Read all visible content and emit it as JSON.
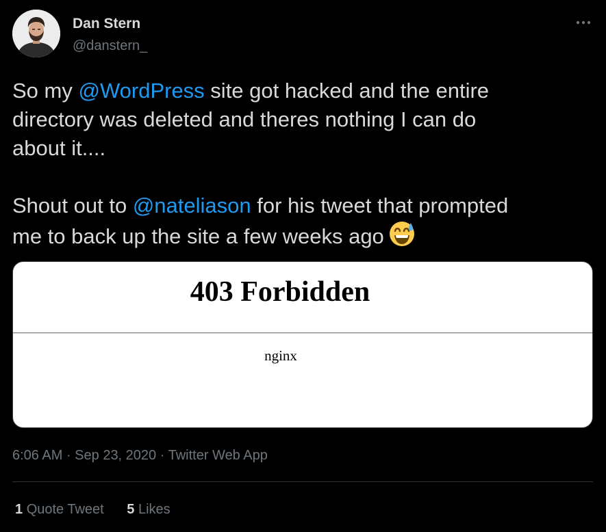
{
  "author": {
    "name": "Dan Stern",
    "handle": "@danstern_"
  },
  "more_label": "More options",
  "text": {
    "p1_before": "So my ",
    "p1_mention": "@WordPress",
    "p1_after": " site got hacked and the entire",
    "p1_line2": "directory was deleted and theres nothing I can do",
    "p1_line3": "about it....",
    "p2_before": "Shout out to ",
    "p2_mention": "@nateliason",
    "p2_after": " for his tweet that prompted",
    "p2_line2": "me to back up the site a few weeks ago",
    "emoji_icon": "grinning-face-with-sweat-emoji"
  },
  "media": {
    "heading": "403 Forbidden",
    "server": "nginx"
  },
  "meta": {
    "time": "6:06 AM",
    "separator": " · ",
    "date": "Sep 23, 2020",
    "source": "Twitter Web App"
  },
  "stats": {
    "quote_count": "1",
    "quote_label": "Quote Tweet",
    "like_count": "5",
    "like_label": "Likes"
  },
  "colors": {
    "background": "#000000",
    "text": "#d9d9d9",
    "secondary": "#6e767d",
    "mention": "#1d9bf0",
    "divider": "#2f3336"
  }
}
